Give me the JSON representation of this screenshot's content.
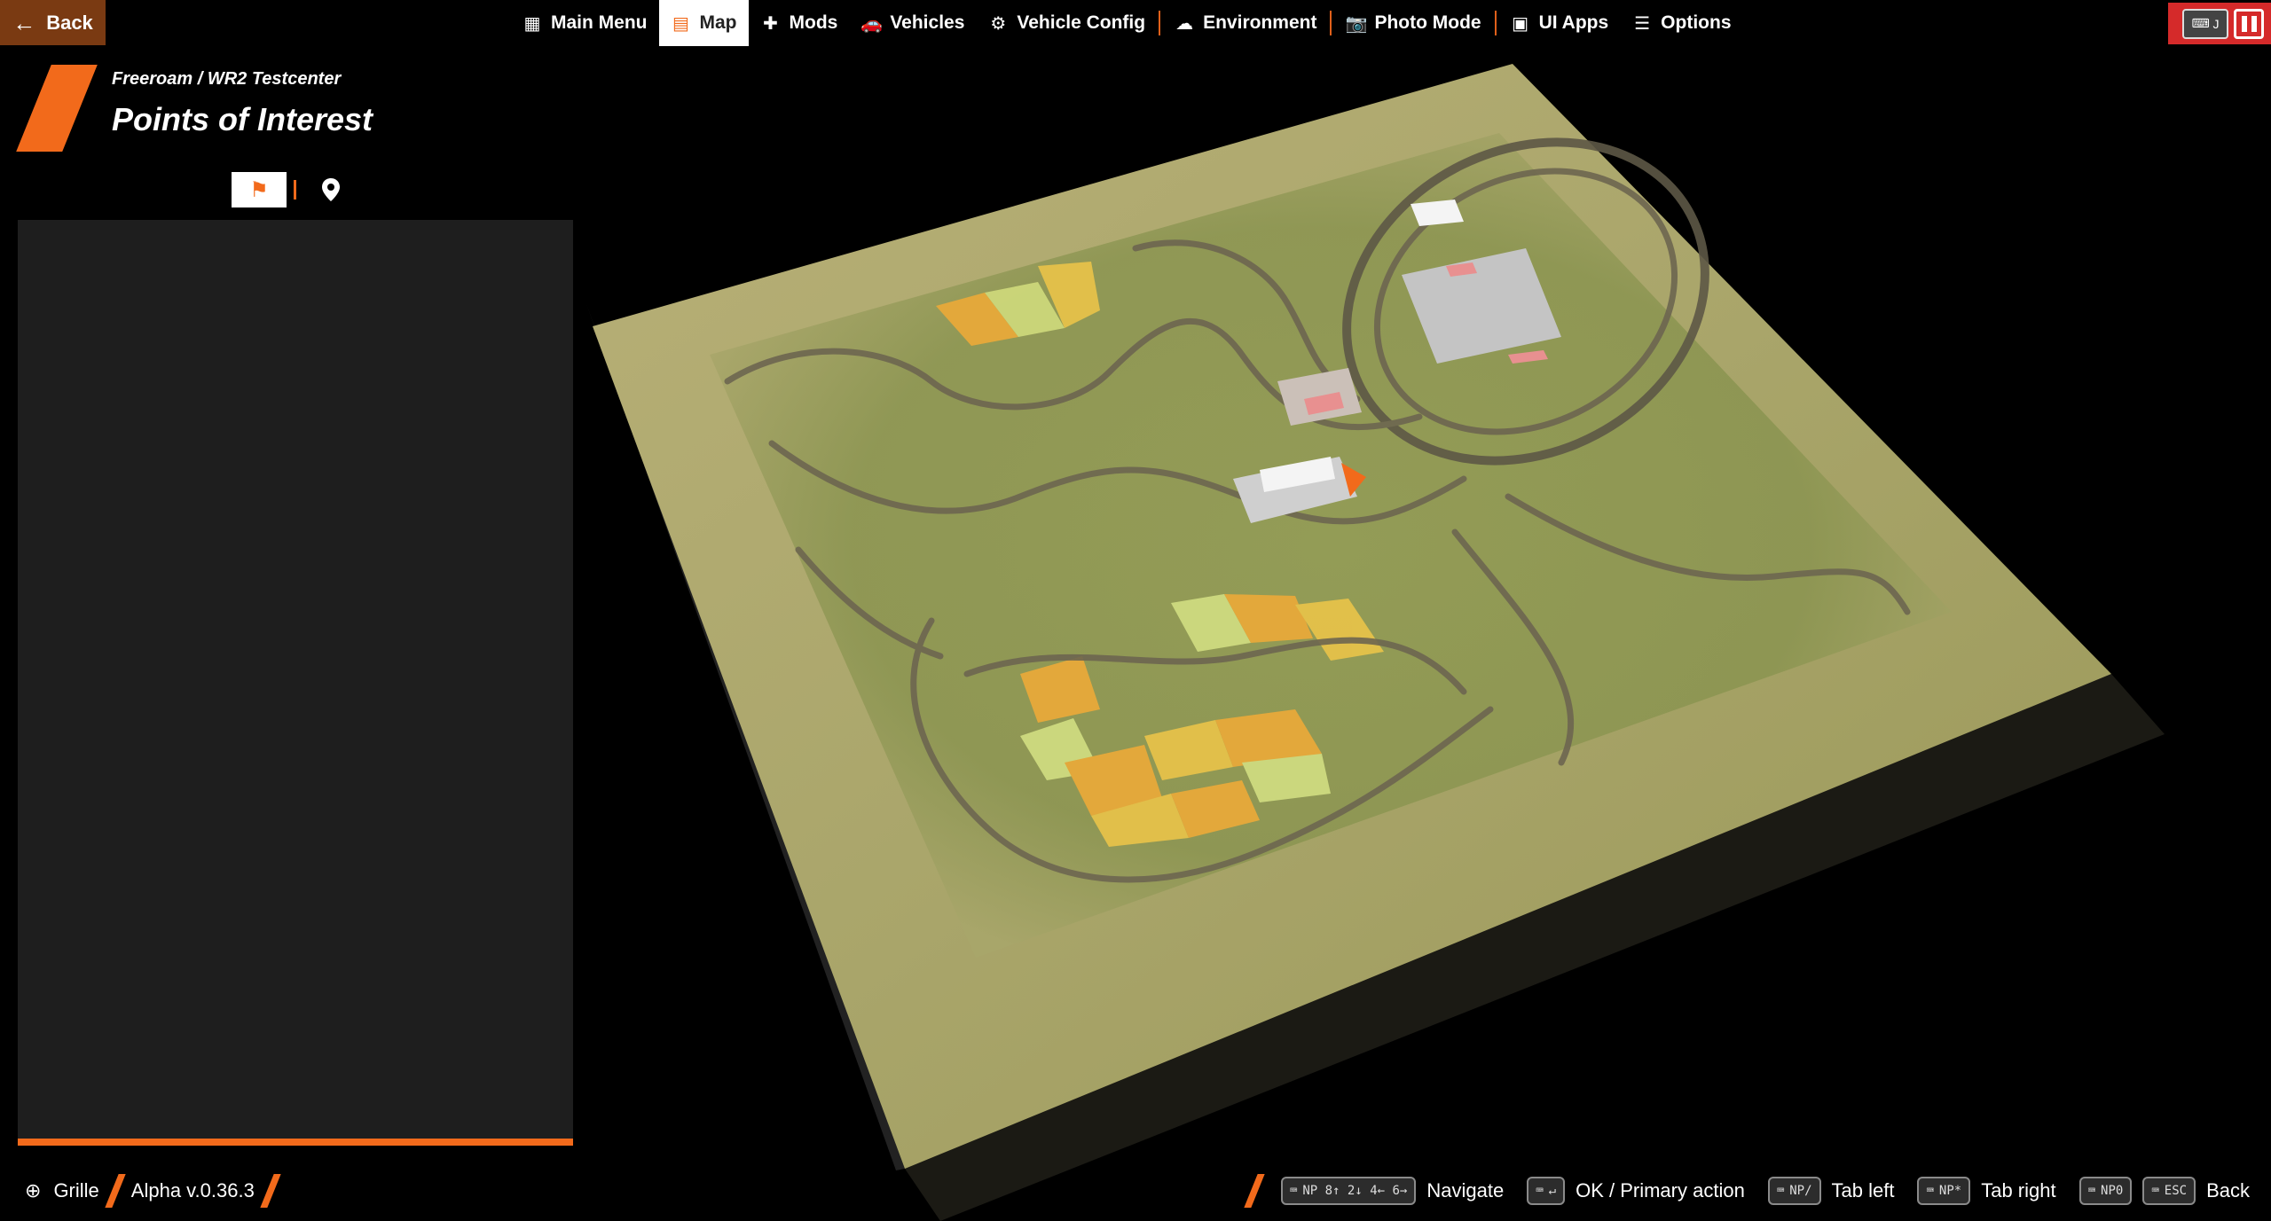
{
  "topbar": {
    "back_label": "Back",
    "nav": [
      {
        "label": "Main Menu",
        "icon": "grid-icon",
        "glyph": "▦",
        "active": false
      },
      {
        "label": "Map",
        "icon": "map-icon",
        "glyph": "▤",
        "active": true
      },
      {
        "label": "Mods",
        "icon": "puzzle-icon",
        "glyph": "✚",
        "active": false
      },
      {
        "label": "Vehicles",
        "icon": "car-icon",
        "glyph": "🚗",
        "active": false
      },
      {
        "label": "Vehicle Config",
        "icon": "engine-icon",
        "glyph": "⚙",
        "active": false
      },
      {
        "label": "Environment",
        "icon": "weather-icon",
        "glyph": "☁",
        "active": false
      },
      {
        "label": "Photo Mode",
        "icon": "camera-icon",
        "glyph": "📷",
        "active": false
      },
      {
        "label": "UI Apps",
        "icon": "apps-icon",
        "glyph": "▣",
        "active": false
      },
      {
        "label": "Options",
        "icon": "sliders-icon",
        "glyph": "☰",
        "active": false
      }
    ],
    "kbd_j": "J"
  },
  "header": {
    "breadcrumb": "Freeroam / WR2 Testcenter",
    "title": "Points of Interest"
  },
  "mode_tabs": [
    {
      "icon": "flag-icon",
      "glyph": "⚑",
      "active": true
    },
    {
      "icon": "pin-icon",
      "glyph": "⬤",
      "active": false
    }
  ],
  "bottom": {
    "user": "Grille",
    "version": "Alpha v.0.36.3",
    "hints": [
      {
        "keys": "NP 8↑ 2↓ 4← 6→",
        "label": "Navigate"
      },
      {
        "keys": "↵",
        "label": "OK / Primary action"
      },
      {
        "keys": "NP/",
        "label": "Tab left"
      },
      {
        "keys": "NP*",
        "label": "Tab right"
      },
      {
        "keys": "NP0",
        "keys2": "ESC",
        "label": "Back"
      }
    ]
  },
  "colors": {
    "accent": "#f26a1b",
    "back_bg": "#7a3a12",
    "pause_bg": "#d52a2a",
    "panel_bg": "#1e1e1e"
  }
}
